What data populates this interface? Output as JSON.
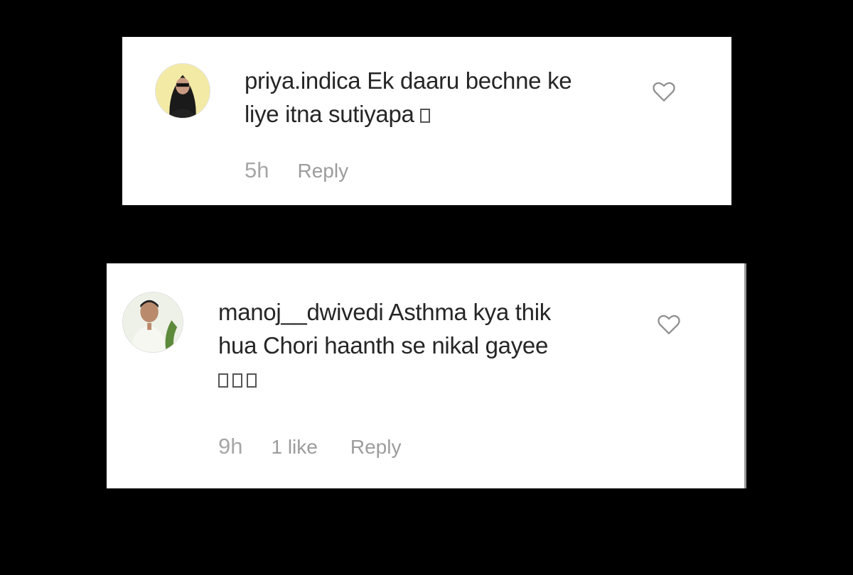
{
  "comments": [
    {
      "username": "priya.indica",
      "text_line1": "Ek daaru bechne ke",
      "text_line2": "liye itna sutiyapa",
      "emoji_count": 1,
      "time": "5h",
      "likes": "",
      "reply_label": "Reply",
      "avatar_icon": "user-avatar-woman",
      "like_icon": "heart-outline-icon"
    },
    {
      "username": "manoj__dwivedi",
      "text_line1": "Asthma kya thik",
      "text_line2": "hua Chori haanth se nikal gayee",
      "emoji_count": 3,
      "time": "9h",
      "likes": "1 like",
      "reply_label": "Reply",
      "avatar_icon": "user-avatar-man",
      "like_icon": "heart-outline-icon"
    }
  ],
  "colors": {
    "background": "#000000",
    "card": "#ffffff",
    "text": "#262626",
    "meta": "#a6a6a6"
  }
}
